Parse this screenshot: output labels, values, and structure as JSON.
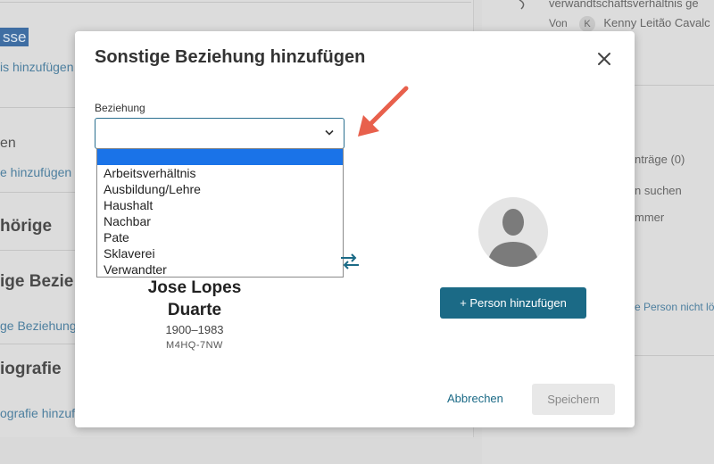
{
  "background": {
    "left": {
      "highlight_text": "sse",
      "link1": "is hinzufügen",
      "text1": "en",
      "link2": "e hinzufügen",
      "head1": "hörige",
      "head2": "ige Bezie",
      "link3": "ge Beziehung",
      "head3": "iografie",
      "link4": "ografie hinzuf"
    },
    "right": {
      "line1": "verwandtschaftsverhältnis ge",
      "von_label": "Von",
      "von_initial": "K",
      "von_name": "Kenny Leitão Cavalc",
      "text1": "nträge (0)",
      "text2": "n suchen",
      "text3": "mmer",
      "link1": "e Person nicht lö"
    }
  },
  "modal": {
    "title": "Sonstige Beziehung hinzufügen",
    "close_icon": "close-icon",
    "field_label": "Beziehung",
    "select_value": "",
    "options": [
      "",
      "Arbeitsverhältnis",
      "Ausbildung/Lehre",
      "Haushalt",
      "Nachbar",
      "Pate",
      "Sklaverei",
      "Verwandter"
    ],
    "person": {
      "name_line1": "Jose Lopes",
      "name_line2": "Duarte",
      "dates": "1900–1983",
      "id": "M4HQ-7NW"
    },
    "add_person_label": "+  Person hinzufügen",
    "cancel_label": "Abbrechen",
    "save_label": "Speichern"
  },
  "colors": {
    "accent": "#1b6a86",
    "selected_option": "#1a73e8",
    "annotation_arrow": "#e8604c"
  }
}
